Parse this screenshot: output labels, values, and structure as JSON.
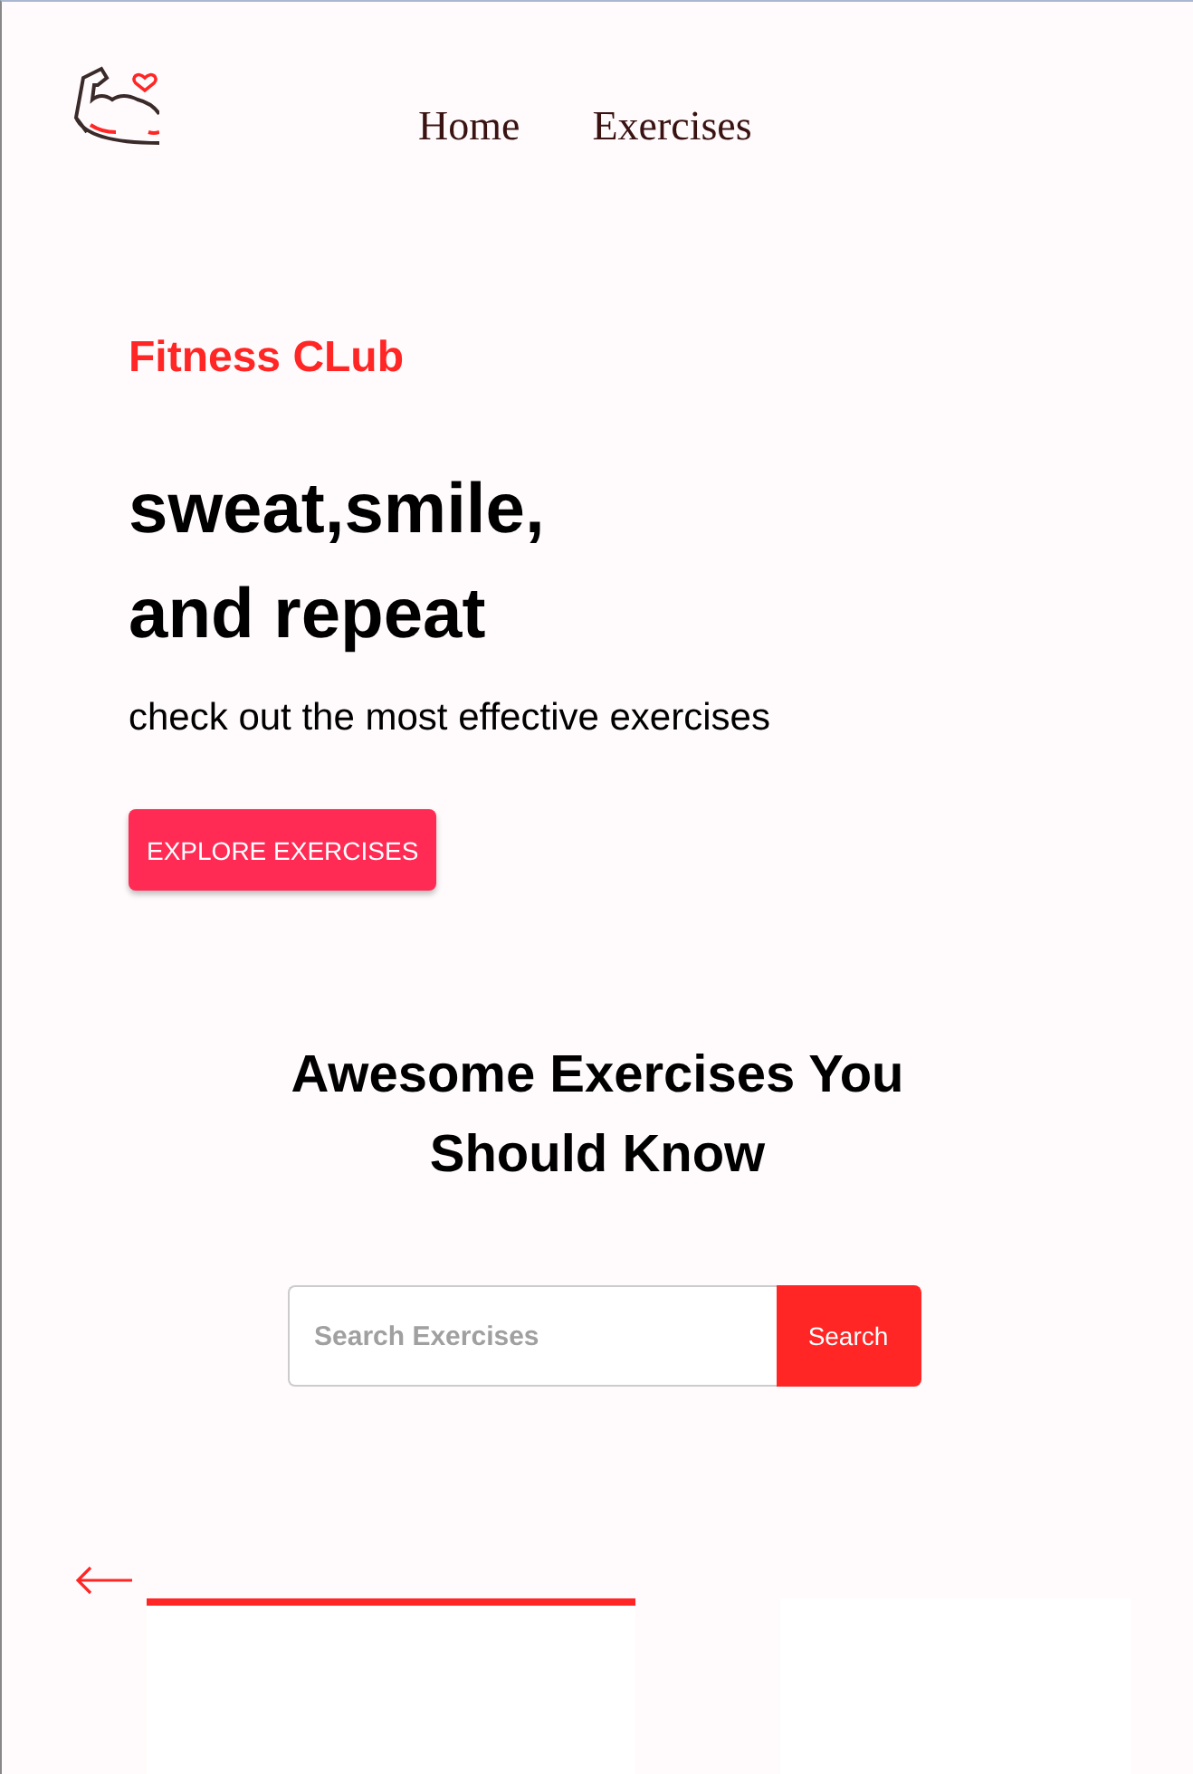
{
  "nav": {
    "links": [
      "Home",
      "Exercises"
    ]
  },
  "hero": {
    "tagline": "Fitness CLub",
    "headline": [
      "sweat,smile,",
      "and repeat"
    ],
    "subtitle": "check out the most effective exercises",
    "button": "EXPLORE EXERCISES"
  },
  "search_section": {
    "title": "Awesome Exercises You Should Know",
    "placeholder": "Search Exercises",
    "button": "Search"
  },
  "cards": [
    {
      "selected": true
    },
    {
      "selected": false
    }
  ]
}
